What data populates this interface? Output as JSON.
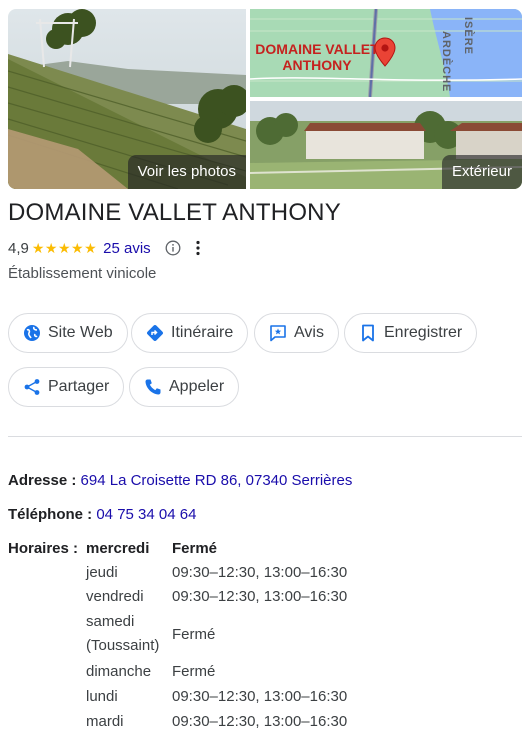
{
  "photos": {
    "main_label": "Voir les photos",
    "map_place_name": "DOMAINE VALLET ANTHONY",
    "map_river_1": "ISÈRE",
    "map_river_2": "ARDÈCHE",
    "exterior_label": "Extérieur"
  },
  "place": {
    "name": "DOMAINE VALLET ANTHONY",
    "rating": "4,9",
    "stars": 5,
    "reviews": "25 avis",
    "category": "Établissement vinicole"
  },
  "actions": {
    "website": "Site Web",
    "directions": "Itinéraire",
    "reviews": "Avis",
    "save": "Enregistrer",
    "share": "Partager",
    "call": "Appeler"
  },
  "details": {
    "address_label": "Adresse :",
    "address": "694 La Croisette RD 86, 07340 Serrières",
    "phone_label": "Téléphone :",
    "phone": "04 75 34 04 64",
    "hours_label": "Horaires :",
    "hours": [
      {
        "day": "mercredi",
        "time": "Fermé",
        "current": true
      },
      {
        "day": "jeudi",
        "time": "09:30–12:30, 13:00–16:30"
      },
      {
        "day": "vendredi",
        "time": "09:30–12:30, 13:00–16:30"
      },
      {
        "day": "samedi",
        "day2": "(Toussaint)",
        "time": "Fermé"
      },
      {
        "day": "dimanche",
        "time": "Fermé"
      },
      {
        "day": "lundi",
        "time": "09:30–12:30, 13:00–16:30"
      },
      {
        "day": "mardi",
        "time": "09:30–12:30, 13:00–16:30"
      }
    ]
  },
  "colors": {
    "link": "#1a0dab",
    "star": "#fbbc04",
    "icon_blue": "#1a73e8",
    "pin_red": "#ea4335"
  }
}
